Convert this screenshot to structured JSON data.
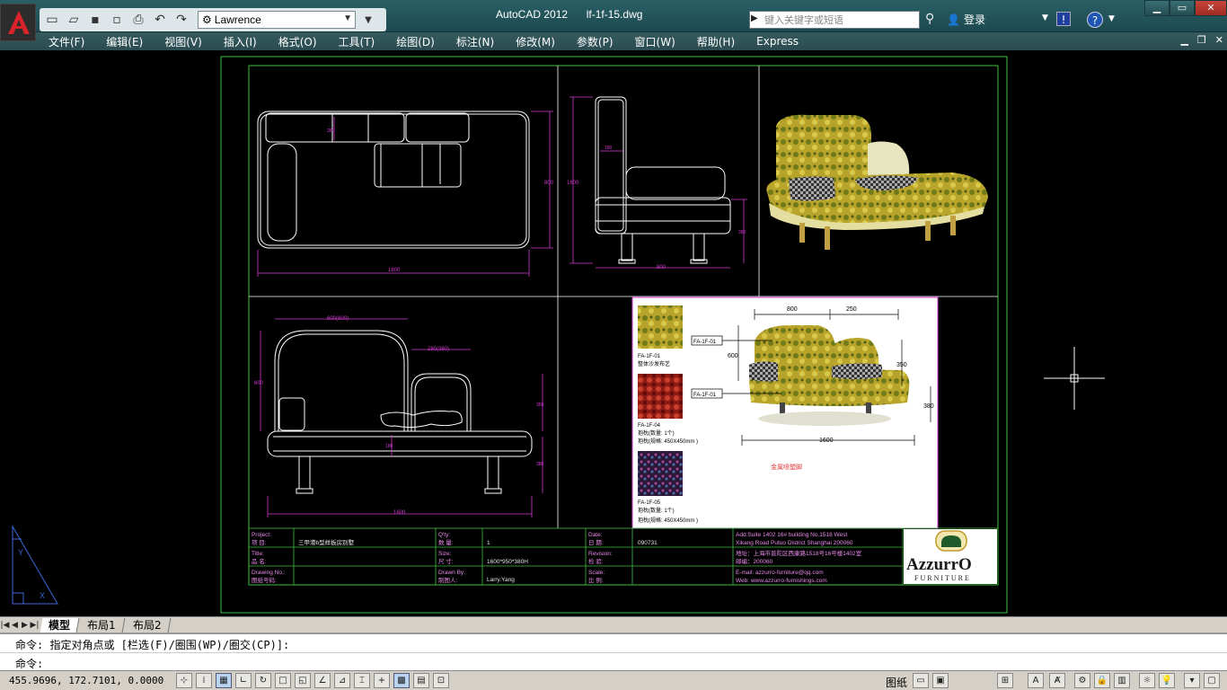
{
  "titlebar": {
    "app_name": "AutoCAD 2012",
    "file_name": "lf-1f-15.dwg",
    "workspace": "Lawrence",
    "search_placeholder": "键入关键字或短语",
    "login_label": "登录"
  },
  "menu": [
    "文件(F)",
    "编辑(E)",
    "视图(V)",
    "插入(I)",
    "格式(O)",
    "工具(T)",
    "绘图(D)",
    "标注(N)",
    "修改(M)",
    "参数(P)",
    "窗口(W)",
    "帮助(H)",
    "Express"
  ],
  "tabs": [
    {
      "label": "模型",
      "active": true
    },
    {
      "label": "布局1",
      "active": false
    },
    {
      "label": "布局2",
      "active": false
    }
  ],
  "command": {
    "history": "命令: 指定对角点或 [栏选(F)/圈围(WP)/圈交(CP)]:",
    "prompt": "命令:"
  },
  "status": {
    "coords": "455.9696, 172.7101, 0.0000",
    "paper_label": "图纸"
  },
  "drawing": {
    "dims": {
      "top_width": "1600",
      "top_height": "800",
      "top_inner": "280",
      "side_depth": "800",
      "side_height": "1600",
      "side_inner": "180",
      "side_leg": "380",
      "front_width": "1600",
      "front_back_width": "600(800)",
      "front_arm_width": "280(380)",
      "front_height": "600",
      "front_arm_h": "350",
      "front_seat": "380",
      "front_base": "180"
    },
    "sample_panel": {
      "dims": [
        "800",
        "250",
        "600",
        "350",
        "380",
        "1600"
      ],
      "callouts": [
        "FA-1F-01",
        "FA-1F-01"
      ],
      "materials": [
        {
          "code": "FA-1F-01",
          "desc": "整体沙发布艺"
        },
        {
          "code": "FA-1F-04",
          "desc": "抱枕(数量:  1个)",
          "spec": "抱枕(规格:  450X450mm )"
        },
        {
          "code": "FA-1F-05",
          "desc": "抱枕(数量:  1个)",
          "spec": "抱枕(规格:  450X450mm )"
        }
      ],
      "note": "金属喷塑脚"
    },
    "title_block": {
      "project_label_en": "Project:",
      "project_label_cn": "项    目:",
      "project_value": "三甲港b型样板房别墅",
      "qty_label_en": "Q'ty:",
      "qty_label_cn": "数    量:",
      "qty_value": "1",
      "date_label_en": "Date:",
      "date_label_cn": "日    期:",
      "date_value": "090731",
      "title_label_en": "Title:",
      "title_label_cn": "品    名:",
      "size_label_en": "Size:",
      "size_label_cn": "尺    寸:",
      "size_value": "1600*950*380H",
      "revision_label_en": "Revision:",
      "revision_label_cn": "检    验:",
      "drawing_label_en": "Drawing No.:",
      "drawing_label_cn": "图纸号码:",
      "drawnby_label_en": "Drawn By:",
      "drawnby_label_cn": "制图人:",
      "drawnby_value": "Larry.Yang",
      "scale_label_en": "Scale:",
      "scale_label_cn": "比    例:",
      "address_en_1": "Add:Suite 1402 16# building No.1518 West",
      "address_en_2": "Xikang Road Putuo District Shanghai 200060",
      "address_cn_1": "地址：上海市普陀区西康路1518号16号楼1402室",
      "address_cn_2": "邮编：200060",
      "email": "E-mail: azzurro-furniture@qq.com",
      "web": "Web: www.azzurro-furnishings.com",
      "logo_brand": "AzzurrO",
      "logo_sub": "FURNITURE"
    }
  }
}
